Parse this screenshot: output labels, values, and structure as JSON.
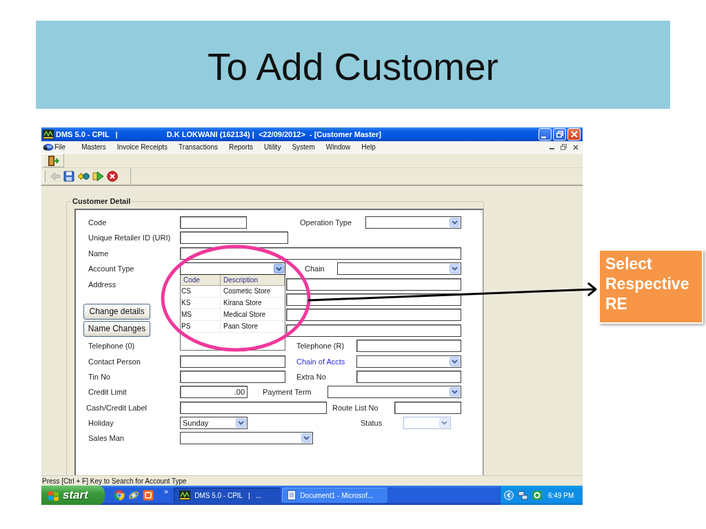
{
  "slide": {
    "title": "To Add Customer"
  },
  "window": {
    "app_title": "DMS 5.0 - CPIL   |",
    "title": "D.K LOKWANI (162134) |  <22/09/2012>  - [Customer Master]"
  },
  "menu": [
    "File",
    "Masters",
    "Invoice Receipts",
    "Transactions",
    "Reports",
    "Utility",
    "System",
    "Window",
    "Help"
  ],
  "toolbar_top": [
    {
      "kind": "exit",
      "disabled": false
    }
  ],
  "toolbar": [
    {
      "kind": "back",
      "disabled": true
    },
    {
      "kind": "save",
      "disabled": false
    },
    {
      "kind": "swap",
      "disabled": false
    },
    {
      "kind": "next",
      "disabled": false
    },
    {
      "kind": "cancel",
      "disabled": false
    }
  ],
  "form": {
    "title": "Customer Detail",
    "rows": [
      {
        "kind": "fields",
        "items": [
          {
            "kind": "label",
            "text": "Code"
          },
          {
            "kind": "text",
            "disabled": false
          },
          {
            "kind": "label",
            "text": "Operation Type"
          },
          {
            "kind": "combo",
            "expanded": false,
            "disabled": false
          }
        ]
      },
      {
        "kind": "fields",
        "items": [
          {
            "kind": "label",
            "text": "Unique Retailer ID (URI)"
          },
          {
            "kind": "text",
            "disabled": false
          }
        ]
      },
      {
        "kind": "fields",
        "items": [
          {
            "kind": "label",
            "text": "Name"
          },
          {
            "kind": "text",
            "disabled": false
          }
        ]
      },
      {
        "kind": "fields",
        "items": [
          {
            "kind": "label",
            "text": "Account Type"
          },
          {
            "kind": "combo",
            "expanded": true,
            "disabled": false,
            "list": {
              "columns": [
                "Code",
                "Description"
              ],
              "rows": [
                {
                  "code": "CS",
                  "description": "Cosmetic Store"
                },
                {
                  "code": "KS",
                  "description": "Kirana Store"
                },
                {
                  "code": "MS",
                  "description": "Medical Store"
                },
                {
                  "code": "PS",
                  "description": "Paan Store"
                }
              ]
            }
          },
          {
            "kind": "label",
            "text": "Chain"
          },
          {
            "kind": "combo",
            "expanded": false,
            "disabled": false
          }
        ]
      },
      {
        "kind": "address",
        "label": "Address",
        "lines": [
          {
            "kind": "text",
            "disabled": false
          },
          {
            "kind": "text",
            "disabled": false
          },
          {
            "kind": "text",
            "disabled": false
          },
          {
            "kind": "text",
            "disabled": false
          }
        ],
        "buttons": [
          "Change details",
          "Name Changes"
        ]
      },
      {
        "kind": "fields",
        "items": [
          {
            "kind": "label",
            "text": "Telephone (0)"
          },
          {
            "kind": "label",
            "text": "Telephone (R)"
          },
          {
            "kind": "text",
            "disabled": false
          }
        ]
      },
      {
        "kind": "fields",
        "items": [
          {
            "kind": "label",
            "text": "Contact Person"
          },
          {
            "kind": "text",
            "disabled": false
          },
          {
            "kind": "link",
            "text": "Chain of Accts"
          },
          {
            "kind": "combo",
            "expanded": false,
            "disabled": false
          }
        ]
      },
      {
        "kind": "fields",
        "items": [
          {
            "kind": "label",
            "text": "Tin No"
          },
          {
            "kind": "text",
            "disabled": false
          },
          {
            "kind": "label",
            "text": "Extra No"
          },
          {
            "kind": "text",
            "disabled": false
          }
        ]
      },
      {
        "kind": "fields",
        "items": [
          {
            "kind": "label",
            "text": "Credit Limit"
          },
          {
            "kind": "number",
            "value": ".00",
            "disabled": false
          },
          {
            "kind": "label",
            "text": "Payment Term"
          },
          {
            "kind": "combo",
            "expanded": false,
            "disabled": false
          }
        ]
      },
      {
        "kind": "fields",
        "items": [
          {
            "kind": "label",
            "text": "Cash/Credit Label"
          },
          {
            "kind": "text",
            "disabled": false
          },
          {
            "kind": "label",
            "text": "Route List No"
          },
          {
            "kind": "text",
            "disabled": false
          }
        ]
      },
      {
        "kind": "fields",
        "items": [
          {
            "kind": "label",
            "text": "Holiday"
          },
          {
            "kind": "combo",
            "value": "Sunday",
            "expanded": false,
            "disabled": false
          },
          {
            "kind": "label",
            "text": "Status"
          },
          {
            "kind": "combo",
            "expanded": false,
            "disabled": true
          }
        ]
      },
      {
        "kind": "fields",
        "items": [
          {
            "kind": "label",
            "text": "Sales Man"
          },
          {
            "kind": "combo",
            "expanded": false,
            "disabled": false
          }
        ]
      }
    ]
  },
  "status_bar": "Press [Ctrl + F] Key to Search for Account Type",
  "taskbar": {
    "start": "start",
    "quick_launch": [
      {
        "kind": "browser"
      },
      {
        "kind": "orbit"
      },
      {
        "kind": "tile"
      }
    ],
    "more": "»",
    "tasks": [
      {
        "kind": "app",
        "label": "DMS 5.0 - CPIL   |   ...",
        "selected": true
      },
      {
        "kind": "doc",
        "label": "Document1 - Microsof...",
        "selected": false
      }
    ],
    "tray": [
      {
        "kind": "chevron"
      },
      {
        "kind": "network"
      },
      {
        "kind": "ring"
      }
    ],
    "clock": "6:49 PM"
  },
  "callout": {
    "text": "Select Respective RE"
  }
}
